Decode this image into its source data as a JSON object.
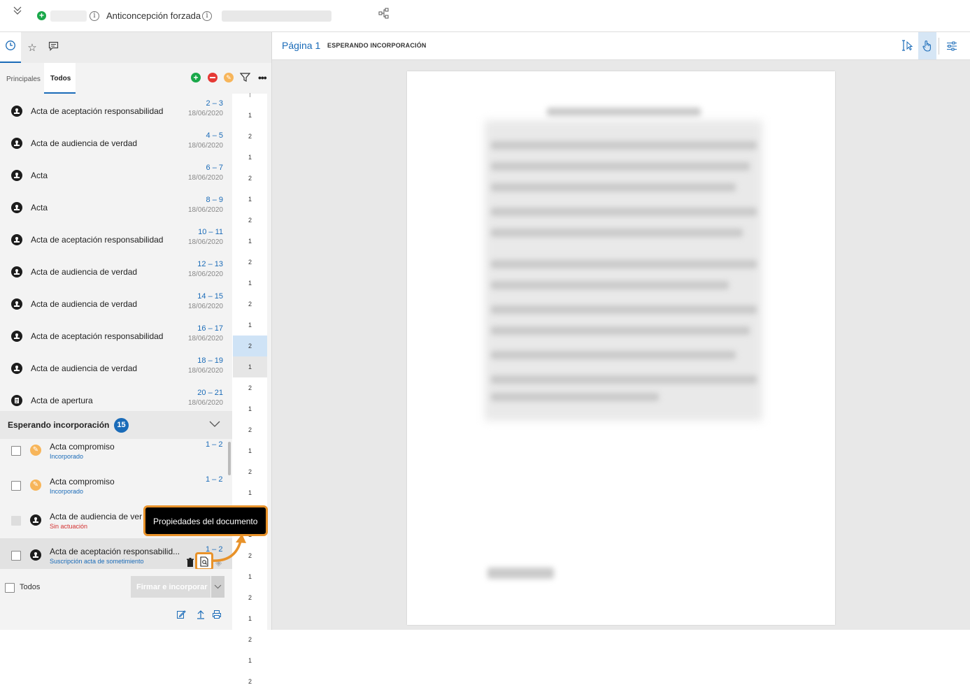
{
  "header": {
    "case_name": "Anticoncepción forzada"
  },
  "left_tabs": {
    "sub_tabs": [
      "Principales",
      "Todos"
    ]
  },
  "documents": [
    {
      "title": "Acta de aceptación responsabilidad",
      "pages": "2 – 3",
      "date": "18/06/2020",
      "icon": "stamp-icon"
    },
    {
      "title": "Acta de audiencia de verdad",
      "pages": "4 – 5",
      "date": "18/06/2020",
      "icon": "stamp-icon"
    },
    {
      "title": "Acta",
      "pages": "6 – 7",
      "date": "18/06/2020",
      "icon": "stamp-icon"
    },
    {
      "title": "Acta",
      "pages": "8 – 9",
      "date": "18/06/2020",
      "icon": "stamp-icon"
    },
    {
      "title": "Acta de aceptación responsabilidad",
      "pages": "10 – 11",
      "date": "18/06/2020",
      "icon": "stamp-icon"
    },
    {
      "title": "Acta de audiencia de verdad",
      "pages": "12 – 13",
      "date": "18/06/2020",
      "icon": "stamp-icon"
    },
    {
      "title": "Acta de audiencia de verdad",
      "pages": "14 – 15",
      "date": "18/06/2020",
      "icon": "stamp-icon"
    },
    {
      "title": "Acta de aceptación responsabilidad",
      "pages": "16 – 17",
      "date": "18/06/2020",
      "icon": "stamp-icon"
    },
    {
      "title": "Acta de audiencia de verdad",
      "pages": "18 – 19",
      "date": "18/06/2020",
      "icon": "stamp-icon"
    },
    {
      "title": "Acta de apertura",
      "pages": "20 – 21",
      "date": "18/06/2020",
      "icon": "document-icon"
    }
  ],
  "page_numbers": [
    "1",
    "2",
    "1",
    "2",
    "1",
    "2",
    "1",
    "2",
    "1",
    "2",
    "1",
    "2",
    "1",
    "2",
    "1",
    "2",
    "1",
    "2",
    "1",
    "2",
    "1",
    "2",
    "1",
    "2",
    "1",
    "2",
    "1",
    "2"
  ],
  "waiting_section": {
    "title": "Esperando incorporación",
    "count": "15",
    "items": [
      {
        "title": "Acta compromiso",
        "status": "Incorporado",
        "pages": "1 – 2",
        "status_color": "#1a6bb8",
        "icon": "pen-icon"
      },
      {
        "title": "Acta compromiso",
        "status": "Incorporado",
        "pages": "1 – 2",
        "status_color": "#1a6bb8",
        "icon": "pen-icon"
      },
      {
        "title": "Acta de audiencia de ver",
        "status": "Sin actuación",
        "pages": "",
        "status_color": "#d32f2f",
        "icon": "stamp-icon"
      },
      {
        "title": "Acta de aceptación responsabilid...",
        "status": "Suscripción acta de sometimiento",
        "pages": "1 – 2",
        "status_color": "#1a6bb8",
        "icon": "stamp-icon"
      }
    ],
    "select_all_label": "Todos",
    "sign_button": "Firmar e incorporar"
  },
  "tooltip": {
    "text": "Propiedades del documento"
  },
  "viewer": {
    "page_label": "Página 1",
    "status": "ESPERANDO INCORPORACIÓN"
  },
  "colors": {
    "accent": "#1a6bb8",
    "highlight": "#e8922a",
    "selected_page_bg": "#cfe3f6"
  }
}
